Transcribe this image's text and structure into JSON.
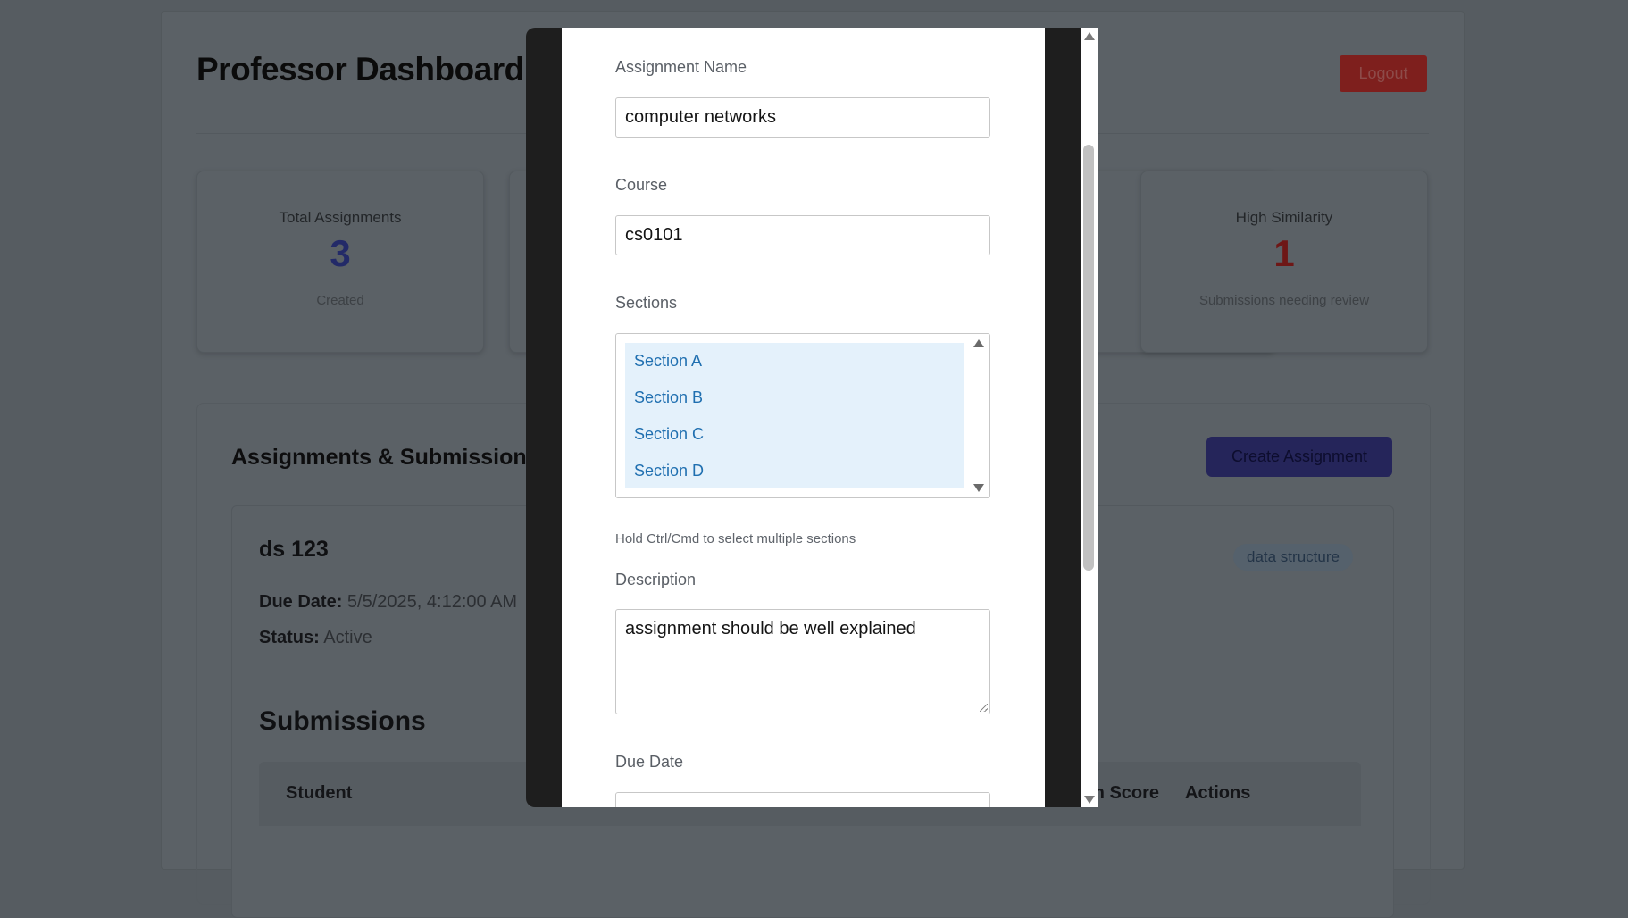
{
  "dashboard": {
    "title": "Professor Dashboard",
    "logout_label": "Logout",
    "stats": [
      {
        "label": "Total Assignments",
        "value": "3",
        "sub": "Created",
        "color": "#232a68"
      },
      {
        "label": "High Similarity",
        "value": "1",
        "sub": "Submissions needing review",
        "color": "#6e1716"
      }
    ],
    "section_title": "Assignments & Submissions",
    "create_label": "Create Assignment",
    "assignment": {
      "title": "ds 123",
      "tag": "data structure",
      "due_label": "Due Date:",
      "due_value": "5/5/2025, 4:12:00 AM",
      "status_label": "Status:",
      "status_value": "Active"
    },
    "submissions_title": "Submissions",
    "table_headers": {
      "student": "Student",
      "score": "sm Score",
      "actions": "Actions"
    }
  },
  "modal": {
    "assignment_name": {
      "label": "Assignment Name",
      "value": "computer networks"
    },
    "course": {
      "label": "Course",
      "value": "cs0101"
    },
    "sections": {
      "label": "Sections",
      "options": [
        "Section A",
        "Section B",
        "Section C",
        "Section D"
      ],
      "hint": "Hold Ctrl/Cmd to select multiple sections"
    },
    "description": {
      "label": "Description",
      "value": "assignment should be well explained"
    },
    "due_date": {
      "label": "Due Date"
    }
  }
}
